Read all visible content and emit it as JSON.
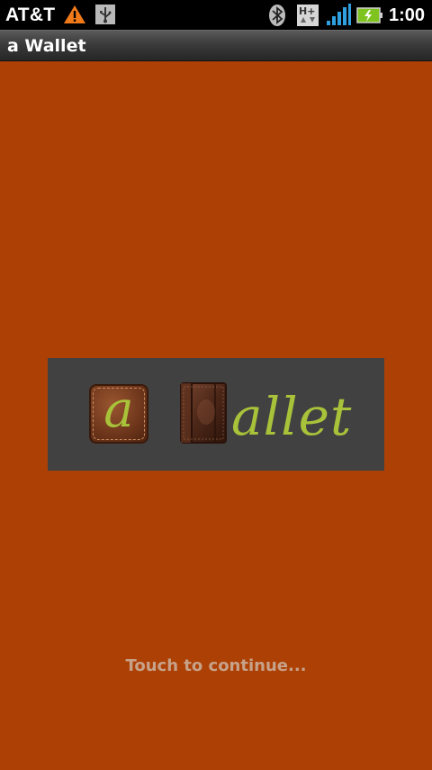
{
  "status_bar": {
    "carrier": "AT&T",
    "time": "1:00",
    "icons": [
      "warning-icon",
      "usb-icon",
      "bluetooth-icon",
      "hplus-network-icon",
      "signal-icon",
      "battery-charging-icon"
    ]
  },
  "title_bar": {
    "title": "a Wallet"
  },
  "logo": {
    "tile_letter": "a",
    "word": "allet",
    "accent_color": "#a8c23a",
    "panel_color": "#414141"
  },
  "background_color": "#ad4105",
  "hint": "Touch to continue..."
}
